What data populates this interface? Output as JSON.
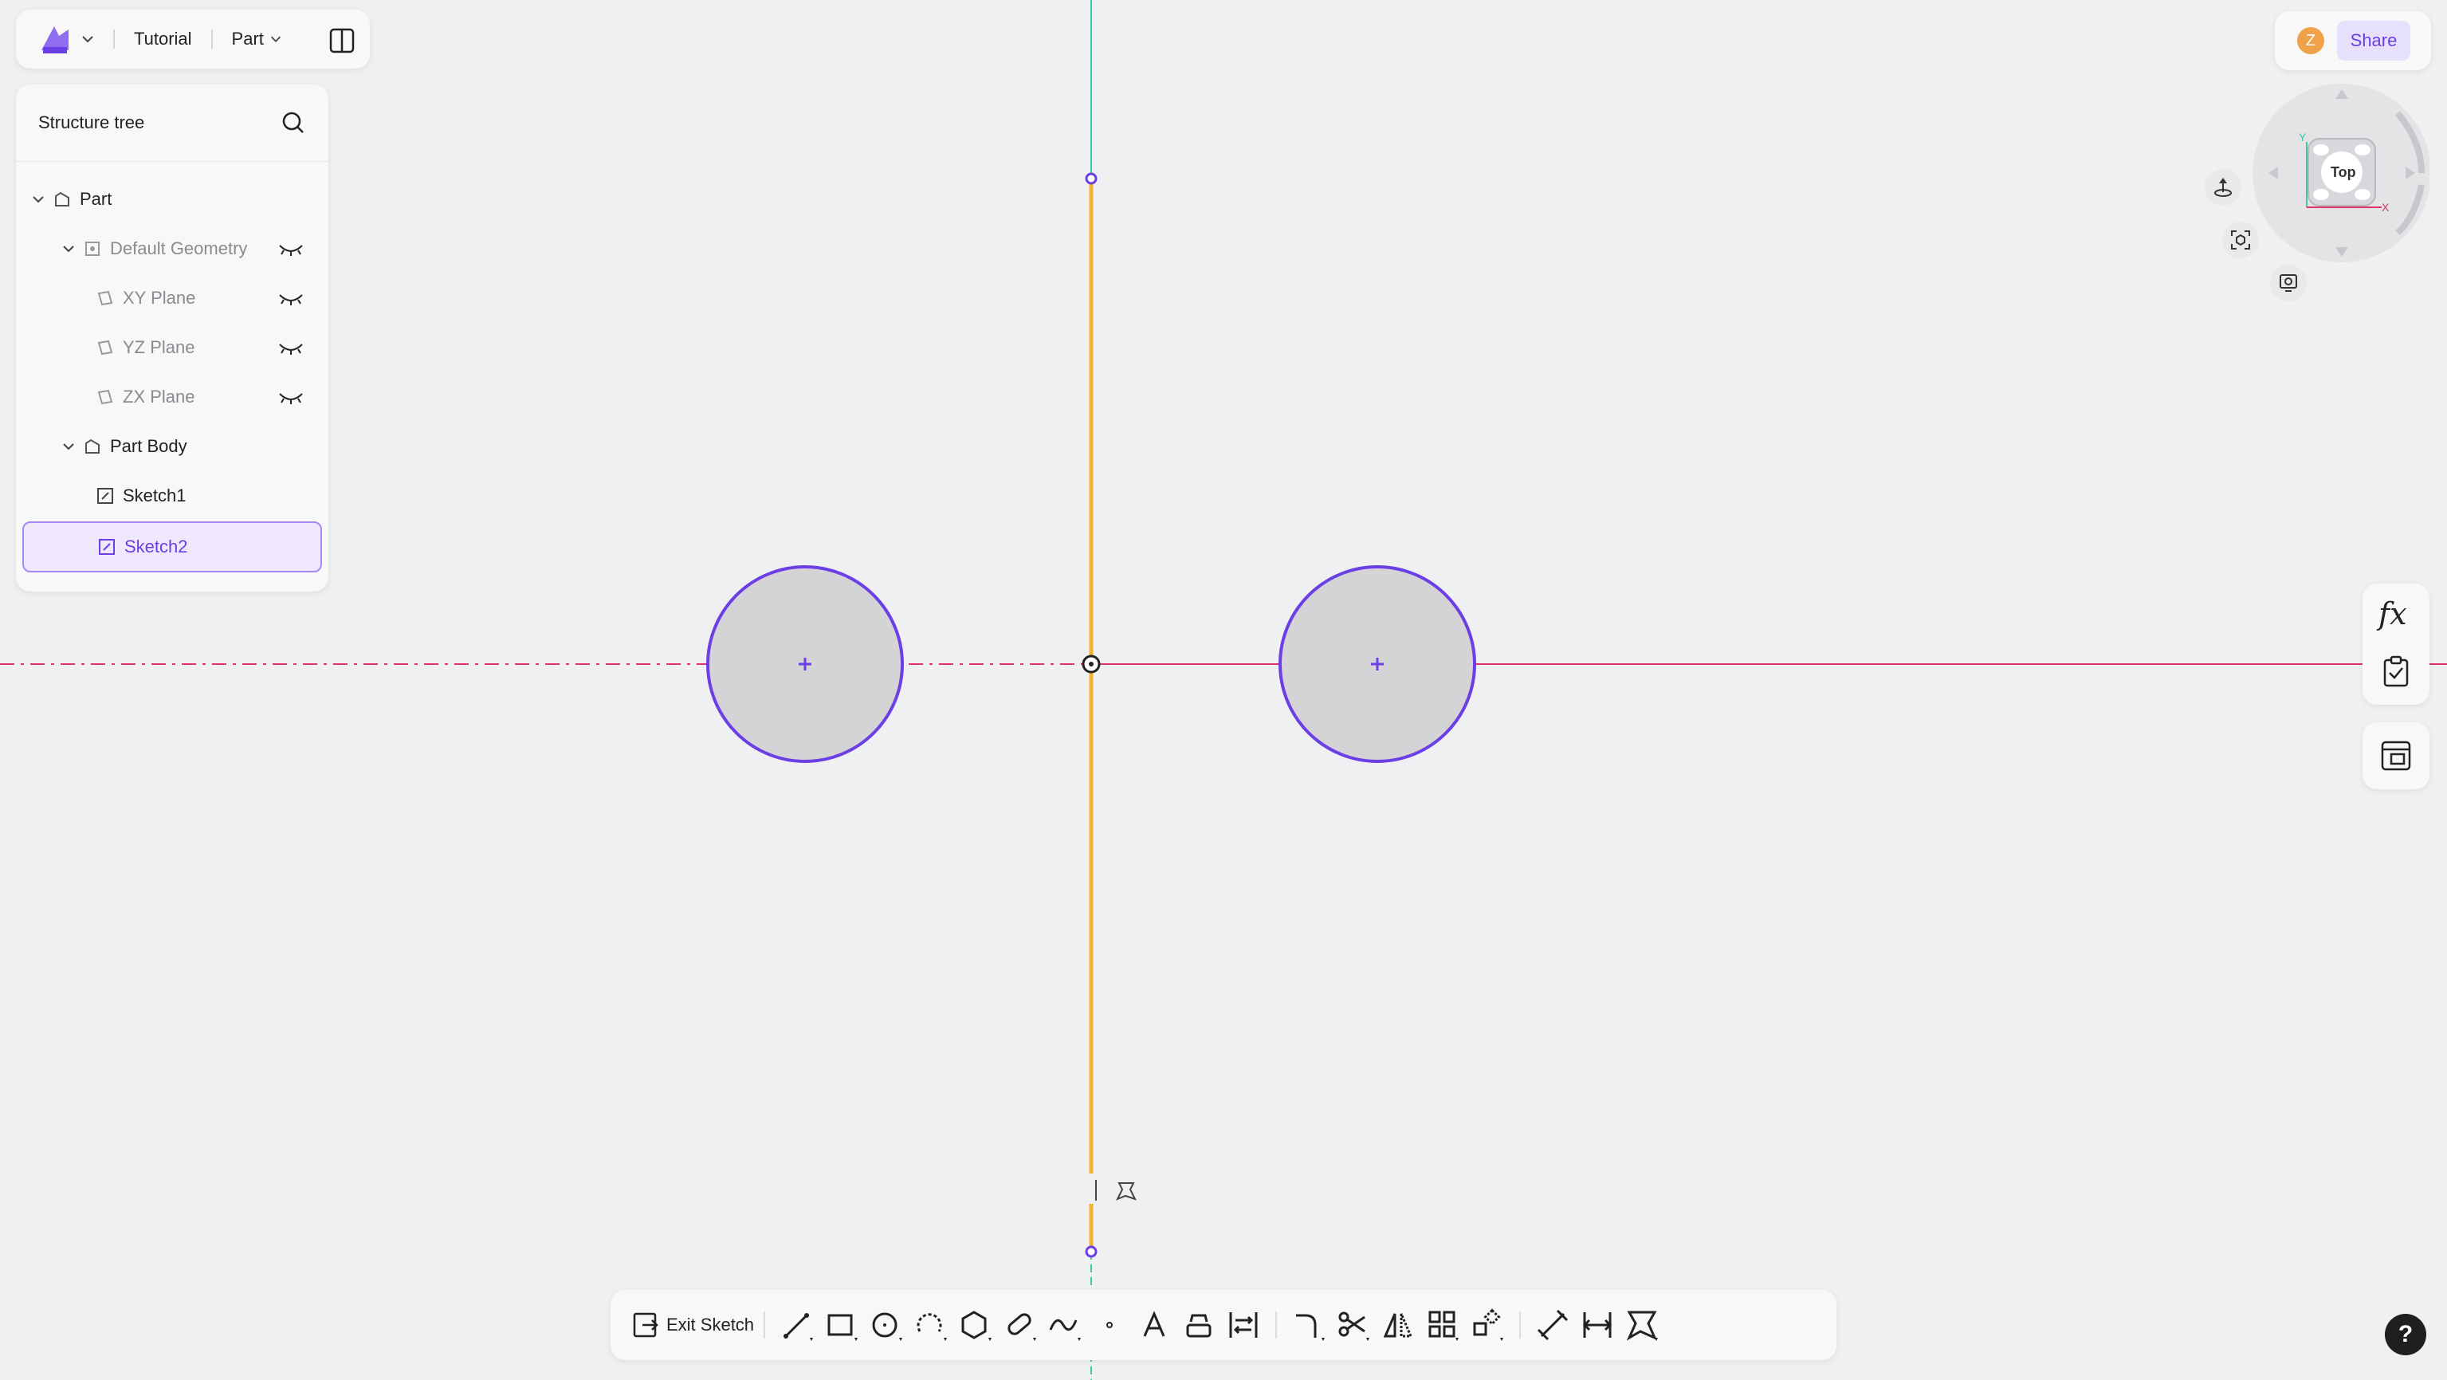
{
  "topbar": {
    "project_name": "Tutorial",
    "mode_label": "Part"
  },
  "tree": {
    "title": "Structure tree",
    "items": [
      {
        "label": "Part"
      },
      {
        "label": "Default Geometry"
      },
      {
        "label": "XY Plane"
      },
      {
        "label": "YZ Plane"
      },
      {
        "label": "ZX Plane"
      },
      {
        "label": "Part Body"
      },
      {
        "label": "Sketch1"
      },
      {
        "label": "Sketch2"
      }
    ]
  },
  "header_right": {
    "avatar_letter": "Z",
    "share_label": "Share"
  },
  "view_cube": {
    "face_label": "Top",
    "axis_y": "Y",
    "axis_x": "X"
  },
  "bottom_toolbar": {
    "exit_label": "Exit Sketch",
    "tools": [
      "line-icon",
      "rectangle-icon",
      "circle-icon",
      "arc-icon",
      "polygon-icon",
      "slot-icon",
      "spline-icon",
      "point-icon",
      "text-icon",
      "offset-icon",
      "convert-icon",
      "fillet-icon",
      "trim-icon",
      "mirror-icon",
      "pattern-icon",
      "transform-icon",
      "dimension-icon",
      "distance-icon",
      "constraint-icon"
    ]
  },
  "side_tools": {
    "fx_label": "fx"
  },
  "help_label": "?",
  "colors": {
    "accent": "#6c3fe6",
    "construction_line": "#f2b430",
    "x_axis": "#e0336a",
    "y_axis": "#3cc9a0",
    "circle_fill": "#d4d4d6"
  }
}
